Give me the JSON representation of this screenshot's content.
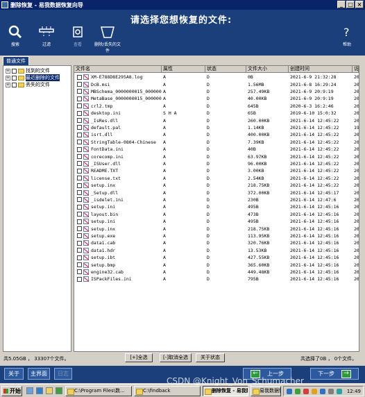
{
  "window": {
    "title": "删除恢复 - 易我数据恢复向导"
  },
  "header": {
    "headline": "请选择您想恢复的文件:"
  },
  "toolbar": {
    "search": "搜索",
    "filter": "过滤",
    "view": "查看",
    "delete_format": "删除/丢失的文件",
    "help": "帮助"
  },
  "tab": {
    "label": "普通文件"
  },
  "tree": [
    {
      "label": "找到的文件",
      "expander": "+"
    },
    {
      "label": "最近删除的文件",
      "expander": "+",
      "selected": true
    },
    {
      "label": "丢失的文件",
      "expander": "+"
    }
  ],
  "columns": [
    "文件名",
    "属性",
    "状态",
    "文件大小",
    "创建时间",
    "访"
  ],
  "rows": [
    [
      "XM-E788D8E295A8.log",
      "A",
      "D",
      "0B",
      "2021-6-9 21:32:28",
      "20"
    ],
    [
      "DcB.msi",
      "A",
      "D",
      "1.56MB",
      "2021-6-8 16:29:24",
      "20"
    ],
    [
      "MBSchema_0000000015_0000000",
      "A",
      "D",
      "257.49KB",
      "2021-6-9 20:9:19",
      "20"
    ],
    [
      "MetaBase_0000000015_0000000",
      "A",
      "D",
      "40.00KB",
      "2021-6-9 20:9:19",
      "20"
    ],
    [
      "crl2.tmp",
      "A",
      "D",
      "645B",
      "2020-6-3 16:2:46",
      "20"
    ],
    [
      "desktop.ini",
      "S H A",
      "D",
      "65B",
      "2019-6-10 15:0:32",
      "20"
    ],
    [
      "_IsRes.dll",
      "A",
      "D",
      "260.00KB",
      "2021-6-14 12:45:22",
      "20"
    ],
    [
      "default.pal",
      "A",
      "D",
      "1.14KB",
      "2021-6-14 12:45:22",
      "19"
    ],
    [
      "isrt.dll",
      "A",
      "D",
      "400.00KB",
      "2021-6-14 12:45:22",
      "20"
    ],
    [
      "StringTable-0804-Chinese",
      "A",
      "D",
      "7.39KB",
      "2021-6-14 12:45:22",
      "20"
    ],
    [
      "FontData.ini",
      "A",
      "D",
      "40B",
      "2021-6-14 12:45:22",
      "20"
    ],
    [
      "corecomp.ini",
      "A",
      "D",
      "63.97KB",
      "2021-6-14 12:45:22",
      "20"
    ],
    [
      "_ISUser.dll",
      "A",
      "D",
      "96.00KB",
      "2021-6-14 12:45:22",
      "20"
    ],
    [
      "README.TXT",
      "A",
      "D",
      "3.00KB",
      "2021-6-14 12:45:22",
      "20"
    ],
    [
      "license.txt",
      "A",
      "D",
      "2.54KB",
      "2021-6-14 12:45:22",
      "20"
    ],
    [
      "setup.inx",
      "A",
      "D",
      "218.75KB",
      "2021-6-14 12:45:22",
      "20"
    ],
    [
      "_Setup.dll",
      "A",
      "D",
      "372.00KB",
      "2021-6-14 12:45:17",
      "20"
    ],
    [
      "_isdelet.ini",
      "A",
      "D",
      "230B",
      "2021-6-14 12:47:6",
      "20"
    ],
    [
      "setup.ini",
      "A",
      "D",
      "495B",
      "2021-6-14 12:45:16",
      "20"
    ],
    [
      "layout.bin",
      "A",
      "D",
      "473B",
      "2021-6-14 12:45:16",
      "20"
    ],
    [
      "setup.ini",
      "A",
      "D",
      "495B",
      "2021-6-14 12:45:16",
      "20"
    ],
    [
      "setup.inx",
      "A",
      "D",
      "218.75KB",
      "2021-6-14 12:45:16",
      "20"
    ],
    [
      "setup.exe",
      "A",
      "D",
      "113.95KB",
      "2021-6-14 12:45:16",
      "20"
    ],
    [
      "data1.cab",
      "A",
      "D",
      "320.76KB",
      "2021-6-14 12:45:16",
      "20"
    ],
    [
      "data1.hdr",
      "A",
      "D",
      "13.53KB",
      "2021-6-14 12:45:16",
      "20"
    ],
    [
      "setup.ibt",
      "A",
      "D",
      "427.55KB",
      "2021-6-14 12:45:16",
      "20"
    ],
    [
      "setup.bmp",
      "A",
      "D",
      "365.60KB",
      "2021-6-14 12:45:16",
      "20"
    ],
    [
      "engine32.cab",
      "A",
      "D",
      "449.48KB",
      "2021-6-14 12:45:16",
      "20"
    ],
    [
      "ISPackFiles.ini",
      "A",
      "D",
      "795B",
      "2021-6-14 12:45:16",
      "20"
    ]
  ],
  "status": {
    "left": "共5.05GB ， 33307个文件。",
    "select_all": "[+]全选",
    "deselect_all": "[-]取消全选",
    "about_status": "关于状态",
    "right": "共选择了0B ， 0个文件。"
  },
  "bottom": {
    "about": "关于",
    "main": "主界面",
    "log": "日志",
    "back": "上一步",
    "next": "下一步"
  },
  "taskbar": {
    "start": "开始",
    "tasks": [
      "C:\\Program Files\\数...",
      "C:\\findback",
      "删除恢复 - 易我数...",
      "易我数据恢复..."
    ],
    "clock": "12:49"
  },
  "watermark": "CSDN @Knight_Von_Schumacher",
  "colors": {
    "header": "#1b3f7a",
    "titlebar": "#0a246a",
    "chrome": "#d4d0c8"
  }
}
